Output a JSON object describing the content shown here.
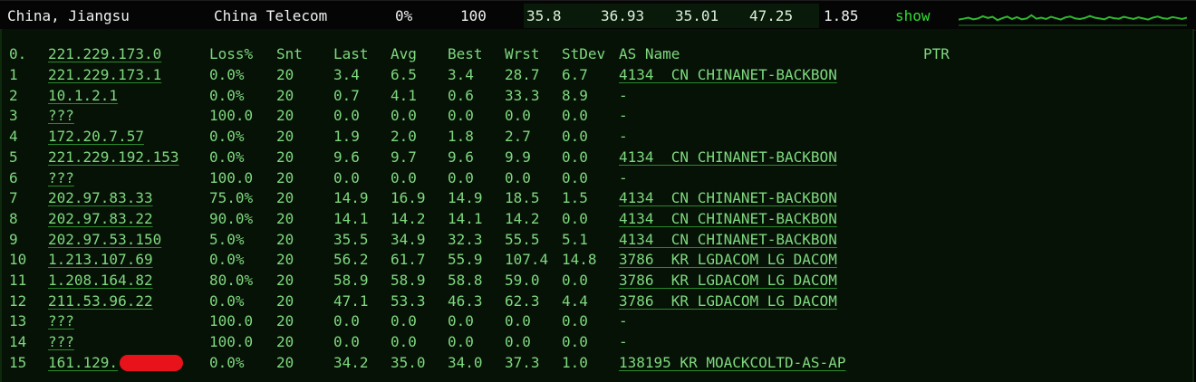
{
  "summary": {
    "location": "China, Jiangsu",
    "isp": "China Telecom",
    "loss": "0%",
    "sent": "100",
    "last": "35.8",
    "avg": "36.93",
    "best": "35.01",
    "worst": "47.25",
    "stdev": "1.85",
    "show_label": "show"
  },
  "sparkline_values": [
    35.8,
    36.1,
    36.5,
    35.9,
    36.2,
    37.0,
    36.4,
    36.8,
    35.6,
    36.3,
    36.9,
    36.0,
    36.7,
    35.9,
    36.2,
    37.4,
    36.1,
    36.5,
    36.0,
    36.8,
    36.3,
    35.8,
    36.6,
    36.9,
    36.2,
    36.0,
    36.4,
    37.1,
    36.5,
    36.2,
    35.9,
    36.7,
    36.3,
    36.1,
    36.8,
    36.4,
    36.0,
    36.6,
    36.2,
    35.8,
    36.5,
    36.9,
    36.3,
    36.1,
    36.7,
    36.4,
    36.0,
    36.5
  ],
  "table": {
    "headers": {
      "hop": "0.",
      "host": "221.229.173.0",
      "loss": "Loss%",
      "snt": "Snt",
      "last": "Last",
      "avg": "Avg",
      "best": "Best",
      "wrst": "Wrst",
      "stdev": "StDev",
      "asname": "AS Name",
      "ptr": "PTR"
    },
    "rows": [
      {
        "hop": "1",
        "host": "221.229.173.1",
        "loss": "0.0%",
        "snt": "20",
        "last": "3.4",
        "avg": "6.5",
        "best": "3.4",
        "wrst": "28.7",
        "stdev": "6.7",
        "as": "4134  CN CHINANET-BACKBON"
      },
      {
        "hop": "2",
        "host": "10.1.2.1",
        "loss": "0.0%",
        "snt": "20",
        "last": "0.7",
        "avg": "4.1",
        "best": "0.6",
        "wrst": "33.3",
        "stdev": "8.9",
        "as": "-"
      },
      {
        "hop": "3",
        "host": "???",
        "loss": "100.0",
        "snt": "20",
        "last": "0.0",
        "avg": "0.0",
        "best": "0.0",
        "wrst": "0.0",
        "stdev": "0.0",
        "as": "-"
      },
      {
        "hop": "4",
        "host": "172.20.7.57",
        "loss": "0.0%",
        "snt": "20",
        "last": "1.9",
        "avg": "2.0",
        "best": "1.8",
        "wrst": "2.7",
        "stdev": "0.0",
        "as": "-"
      },
      {
        "hop": "5",
        "host": "221.229.192.153",
        "loss": "0.0%",
        "snt": "20",
        "last": "9.6",
        "avg": "9.7",
        "best": "9.6",
        "wrst": "9.9",
        "stdev": "0.0",
        "as": "4134  CN CHINANET-BACKBON"
      },
      {
        "hop": "6",
        "host": "???",
        "loss": "100.0",
        "snt": "20",
        "last": "0.0",
        "avg": "0.0",
        "best": "0.0",
        "wrst": "0.0",
        "stdev": "0.0",
        "as": "-"
      },
      {
        "hop": "7",
        "host": "202.97.83.33",
        "loss": "75.0%",
        "snt": "20",
        "last": "14.9",
        "avg": "16.9",
        "best": "14.9",
        "wrst": "18.5",
        "stdev": "1.5",
        "as": "4134  CN CHINANET-BACKBON"
      },
      {
        "hop": "8",
        "host": "202.97.83.22",
        "loss": "90.0%",
        "snt": "20",
        "last": "14.1",
        "avg": "14.2",
        "best": "14.1",
        "wrst": "14.2",
        "stdev": "0.0",
        "as": "4134  CN CHINANET-BACKBON"
      },
      {
        "hop": "9",
        "host": "202.97.53.150",
        "loss": "5.0%",
        "snt": "20",
        "last": "35.5",
        "avg": "34.9",
        "best": "32.3",
        "wrst": "55.5",
        "stdev": "5.1",
        "as": "4134  CN CHINANET-BACKBON"
      },
      {
        "hop": "10",
        "host": "1.213.107.69",
        "loss": "0.0%",
        "snt": "20",
        "last": "56.2",
        "avg": "61.7",
        "best": "55.9",
        "wrst": "107.4",
        "stdev": "14.8",
        "as": "3786  KR LGDACOM LG DACOM"
      },
      {
        "hop": "11",
        "host": "1.208.164.82",
        "loss": "80.0%",
        "snt": "20",
        "last": "58.9",
        "avg": "58.9",
        "best": "58.8",
        "wrst": "59.0",
        "stdev": "0.0",
        "as": "3786  KR LGDACOM LG DACOM"
      },
      {
        "hop": "12",
        "host": "211.53.96.22",
        "loss": "0.0%",
        "snt": "20",
        "last": "47.1",
        "avg": "53.3",
        "best": "46.3",
        "wrst": "62.3",
        "stdev": "4.4",
        "as": "3786  KR LGDACOM LG DACOM"
      },
      {
        "hop": "13",
        "host": "???",
        "loss": "100.0",
        "snt": "20",
        "last": "0.0",
        "avg": "0.0",
        "best": "0.0",
        "wrst": "0.0",
        "stdev": "0.0",
        "as": "-"
      },
      {
        "hop": "14",
        "host": "???",
        "loss": "100.0",
        "snt": "20",
        "last": "0.0",
        "avg": "0.0",
        "best": "0.0",
        "wrst": "0.0",
        "stdev": "0.0",
        "as": "-"
      },
      {
        "hop": "15",
        "host": "161.129.",
        "loss": "0.0%",
        "snt": "20",
        "last": "34.2",
        "avg": "35.0",
        "best": "34.0",
        "wrst": "37.3",
        "stdev": "1.0",
        "as": "138195 KR MOACKCOLTD-AS-AP"
      }
    ]
  },
  "colors": {
    "background": "#000000",
    "panel": "#061206",
    "text_green": "#7fd87f",
    "link_green": "#3fd43f",
    "redaction": "#e8121b"
  }
}
